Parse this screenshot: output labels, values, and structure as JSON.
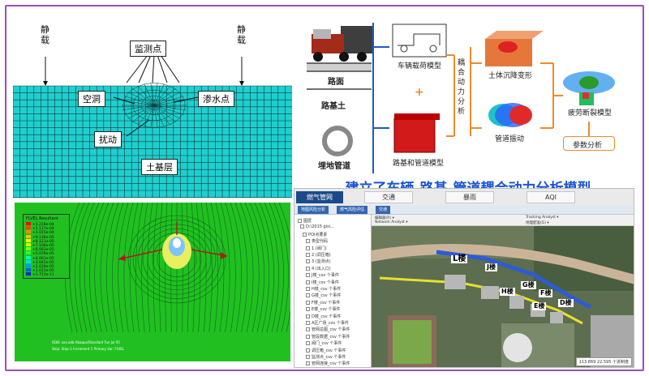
{
  "mesh_panel": {
    "static_load_left": "静载",
    "static_load_right": "静载",
    "monitor_points": "监测点",
    "cavity": "空洞",
    "seepage_point": "渗水点",
    "disturbance": "扰动",
    "soil_layer": "土基层"
  },
  "model_panel": {
    "road_surface": "路面",
    "road_base": "路基土",
    "buried_pipe": "埋地管道",
    "vehicle_model": "车辆载荷模型",
    "subgrade_pipe_model": "路基和管道模型",
    "coupled_analysis": "耦合动力分析",
    "soil_settlement": "土体沉降变形",
    "pipe_vibration": "管道振动",
    "fatigue_model": "疲劳断裂模型",
    "param_analysis": "参数分析",
    "title": "建立了车辆-路基-管道耦合动力分析模型"
  },
  "seepage_panel": {
    "legend_title": "FLVEL Resultant",
    "legend_values": [
      "+1.218e-04",
      "+1.117e-04",
      "+1.015e-04",
      "+9.136e-05",
      "+8.121e-05",
      "+7.106e-05",
      "+6.091e-05",
      "+5.076e-05",
      "+4.061e-05",
      "+3.045e-05",
      "+2.030e-05",
      "+1.015e-05",
      "+1.713e-11"
    ]
  },
  "gis_panel": {
    "tabs": [
      "燃气管网",
      "交通",
      "暴雨",
      "AQI"
    ],
    "sub_tabs": [
      "地图风险分析",
      "燃气风险评估",
      "交通"
    ],
    "tree_items": [
      "图层",
      "D:\\2015 gis\\...",
      "POI点要素",
      "类型代码",
      "1 (阀门)",
      "2 (调压箱)",
      "3 (监测点)",
      "4 (出入口)",
      "J楼_csv 个事件",
      "I楼_csv 个事件",
      "H楼_csv 个事件",
      "G楼_csv 个事件",
      "F楼_csv 个事件",
      "E楼_csv 个事件",
      "D楼_csv 个事件",
      "A区广场_csv 个事件",
      "管网总图_csv 个事件",
      "管段数据_csv 个事件",
      "阀门_csv 个事件",
      "调压箱_csv 个事件",
      "监测点_csv 个事件",
      "管网连接_csv 个事件"
    ],
    "toolbar_left": "编辑器(R) ▾",
    "toolbar_network": "Network Analyst ▾",
    "toolbar_tracking": "Tracking Analyst ▾",
    "toolbar_georef": "地理配准(G) ▾",
    "buildings": [
      "L楼",
      "J楼",
      "H楼",
      "G楼",
      "F楼",
      "E楼",
      "D楼"
    ],
    "coordinates": "113.869 22.595 十进制度"
  },
  "colors": {
    "frame": "#9b4bc4",
    "mesh_fill": "#1fcfcf",
    "title_blue": "#1a55d6",
    "tab_active": "#1b4a8a",
    "seep_green": "#21c021"
  }
}
